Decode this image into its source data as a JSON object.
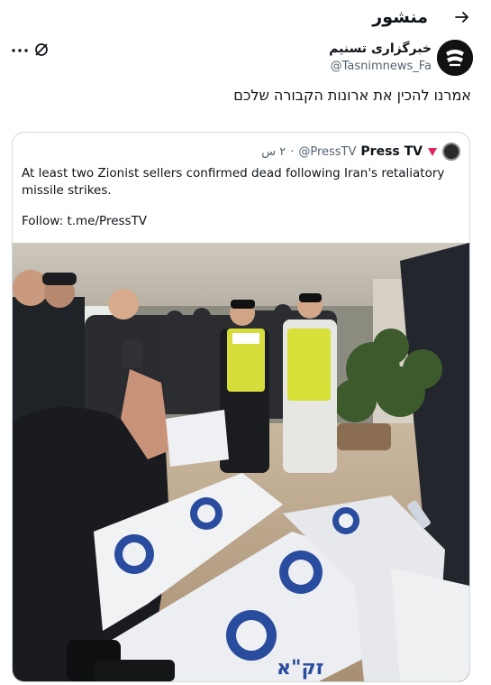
{
  "header": {
    "title": "منشور",
    "back_icon": "arrow-right-icon"
  },
  "author": {
    "name": "خبرگزاری تسنیم",
    "handle": "@Tasnimnews_Fa"
  },
  "post": {
    "text": "אמרנו להכין את ארונות הקבורה שלכם"
  },
  "quote": {
    "name": "Press TV",
    "handle": "@PressTV",
    "dot": "·",
    "time": "۲ س",
    "text": "At least two Zionist sellers confirmed dead following Iran's retaliatory missile strikes.",
    "follow": "Follow: t.me/PressTV",
    "badge_color": "#e0245e"
  },
  "photo": {
    "bag_label": "זק\"א"
  }
}
